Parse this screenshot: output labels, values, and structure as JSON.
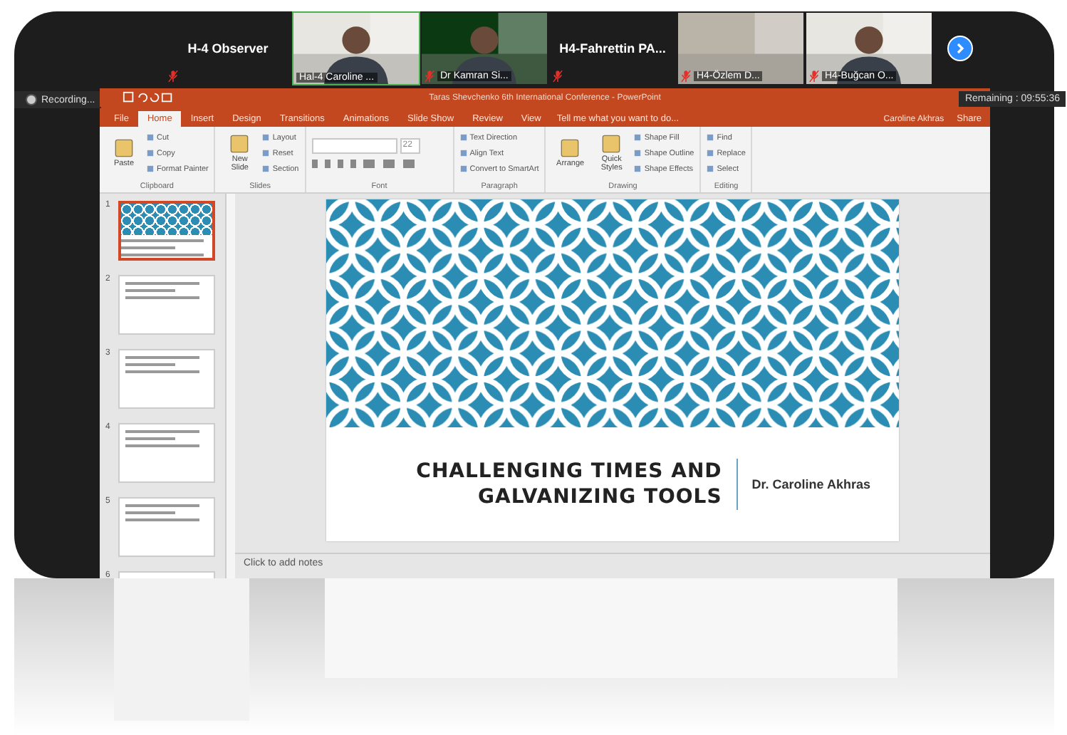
{
  "participants": [
    {
      "kind": "name",
      "name": "H-4 Observer",
      "muted": true,
      "active": false
    },
    {
      "kind": "video",
      "name": "Hal-4 Caroline ...",
      "muted": false,
      "active": true
    },
    {
      "kind": "video",
      "name": "Dr Kamran Si...",
      "muted": true,
      "active": false
    },
    {
      "kind": "name",
      "name": "H4-Fahrettin PA...",
      "muted": true,
      "active": false
    },
    {
      "kind": "video",
      "name": "H4-Özlem D...",
      "muted": true,
      "active": false
    },
    {
      "kind": "video",
      "name": "H4-Buğcan O...",
      "muted": true,
      "active": false
    }
  ],
  "recording": "Recording...",
  "remaining": "Remaining : 09:55:36",
  "powerpoint": {
    "title": "Taras Shevchenko 6th International Conference - PowerPoint",
    "tabs": [
      {
        "label": "File",
        "selected": false
      },
      {
        "label": "Home",
        "selected": true
      },
      {
        "label": "Insert",
        "selected": false
      },
      {
        "label": "Design",
        "selected": false
      },
      {
        "label": "Transitions",
        "selected": false
      },
      {
        "label": "Animations",
        "selected": false
      },
      {
        "label": "Slide Show",
        "selected": false
      },
      {
        "label": "Review",
        "selected": false
      },
      {
        "label": "View",
        "selected": false
      }
    ],
    "tell_me": "Tell me what you want to do...",
    "user": "Caroline Akhras",
    "share": "Share",
    "ribbon": [
      {
        "label": "Clipboard",
        "items": [
          {
            "label": "Paste",
            "kind": "large"
          },
          {
            "label": "Cut",
            "kind": "small"
          },
          {
            "label": "Copy",
            "kind": "small"
          },
          {
            "label": "Format Painter",
            "kind": "small"
          }
        ]
      },
      {
        "label": "Slides",
        "items": [
          {
            "label": "New Slide",
            "kind": "large"
          },
          {
            "label": "Layout",
            "kind": "small"
          },
          {
            "label": "Reset",
            "kind": "small"
          },
          {
            "label": "Section",
            "kind": "small"
          }
        ]
      },
      {
        "label": "Font",
        "font_size": "22"
      },
      {
        "label": "Paragraph",
        "items": [
          {
            "label": "Text Direction",
            "kind": "small"
          },
          {
            "label": "Align Text",
            "kind": "small"
          },
          {
            "label": "Convert to SmartArt",
            "kind": "small"
          }
        ]
      },
      {
        "label": "Drawing",
        "items": [
          {
            "label": "Arrange",
            "kind": "large"
          },
          {
            "label": "Quick Styles",
            "kind": "large"
          },
          {
            "label": "Shape Fill",
            "kind": "small"
          },
          {
            "label": "Shape Outline",
            "kind": "small"
          },
          {
            "label": "Shape Effects",
            "kind": "small"
          }
        ]
      },
      {
        "label": "Editing",
        "items": [
          {
            "label": "Find",
            "kind": "small"
          },
          {
            "label": "Replace",
            "kind": "small"
          },
          {
            "label": "Select",
            "kind": "small"
          }
        ]
      }
    ],
    "thumbnails": [
      {
        "number": "1",
        "selected": true
      },
      {
        "number": "2",
        "selected": false
      },
      {
        "number": "3",
        "selected": false
      },
      {
        "number": "4",
        "selected": false
      },
      {
        "number": "5",
        "selected": false
      },
      {
        "number": "6",
        "selected": false
      }
    ],
    "slide": {
      "title_lines": [
        "CHALLENGING TIMES AND",
        "GALVANIZING TOOLS"
      ],
      "subtitle": "Dr. Caroline Akhras"
    },
    "notes_placeholder": "Click to add notes"
  }
}
